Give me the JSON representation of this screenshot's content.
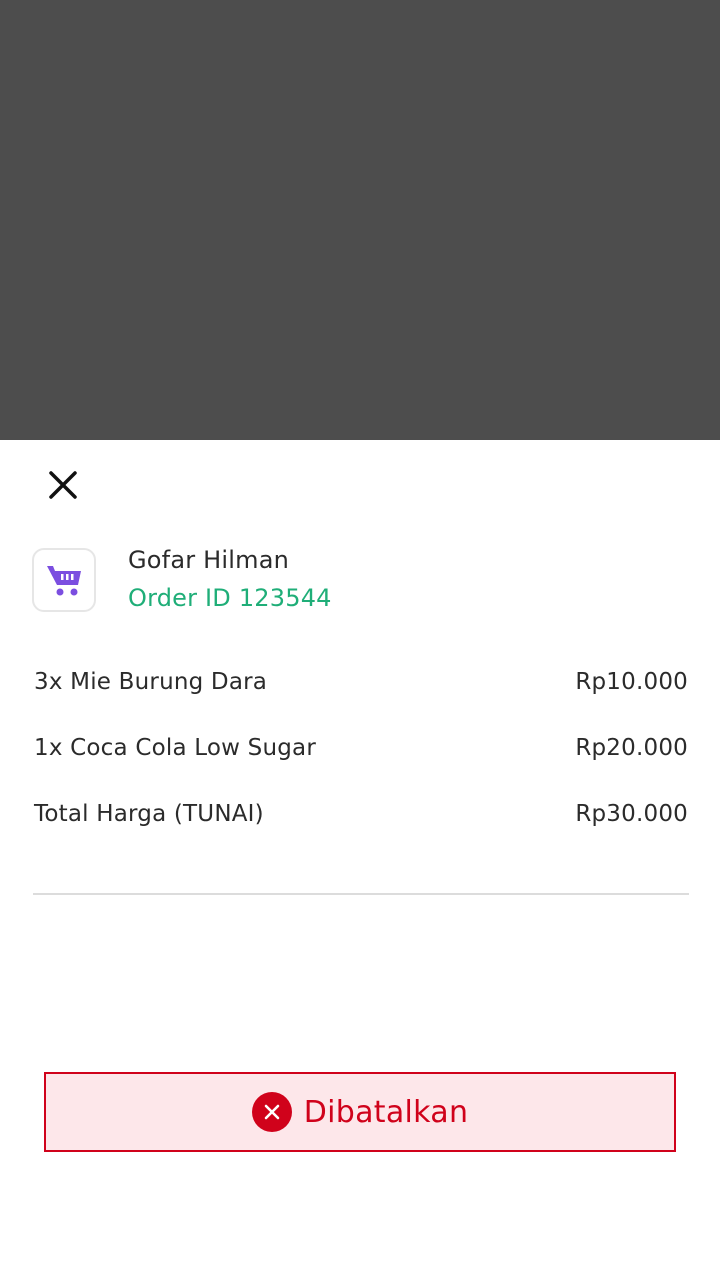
{
  "order": {
    "customer_name": "Gofar Hilman",
    "order_id_label": "Order ID 123544",
    "items": [
      {
        "label": "3x Mie Burung Dara",
        "price": "Rp10.000"
      },
      {
        "label": "1x Coca Cola Low Sugar",
        "price": "Rp20.000"
      }
    ],
    "total": {
      "label": "Total Harga (TUNAI)",
      "price": "Rp30.000"
    }
  },
  "status": {
    "label": "Dibatalkan",
    "icon": "close-circle-icon",
    "color": "#d0021b",
    "background": "#fde7ea"
  },
  "icons": {
    "close": "close-icon",
    "store": "shopping-cart-icon"
  },
  "colors": {
    "overlay": "#4d4d4d",
    "order_id": "#1fae78",
    "cart_icon": "#7b4ee0"
  }
}
